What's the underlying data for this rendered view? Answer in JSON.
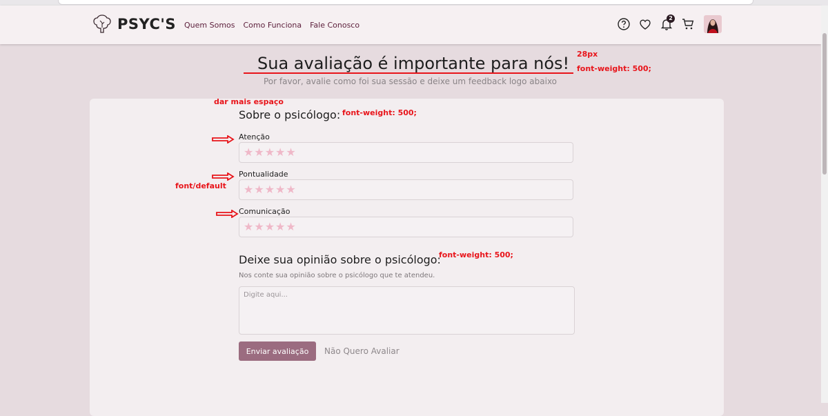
{
  "navbar": {
    "logo_text": "PSYC'S",
    "links": [
      "Quem Somos",
      "Como Funciona",
      "Fale Conosco"
    ],
    "notification_count": "2"
  },
  "header": {
    "title": "Sua avaliação é importante para nós!",
    "subtitle": "Por favor, avalie como foi sua sessão e deixe um feedback logo abaixo"
  },
  "form": {
    "section1_title": "Sobre o psicólogo:",
    "ratings": [
      {
        "label": "Atenção",
        "stars": 0,
        "max": 5
      },
      {
        "label": "Pontualidade",
        "stars": 0,
        "max": 5
      },
      {
        "label": "Comunicação",
        "stars": 0,
        "max": 5
      }
    ],
    "section2_title": "Deixe sua opinião sobre o psicólogo:",
    "help_text": "Nos conte sua opinião sobre o psicólogo que te atendeu.",
    "textarea_placeholder": "Digite aqui...",
    "submit_label": "Enviar avaliação",
    "skip_label": "Não Quero Avaliar"
  },
  "annotations": {
    "title_size": "28px",
    "title_weight": "font-weight: 500;",
    "more_space": "dar mais espaço",
    "section1_weight": "font-weight: 500;",
    "label_font": "font/default",
    "section2_weight": "font-weight: 500;"
  },
  "colors": {
    "background": "#e6dbdf",
    "card": "#f3eef0",
    "nav_link": "#5b1d3a",
    "star": "#efb8c8",
    "button": "#9b6c80",
    "annotation": "#e8141a"
  }
}
